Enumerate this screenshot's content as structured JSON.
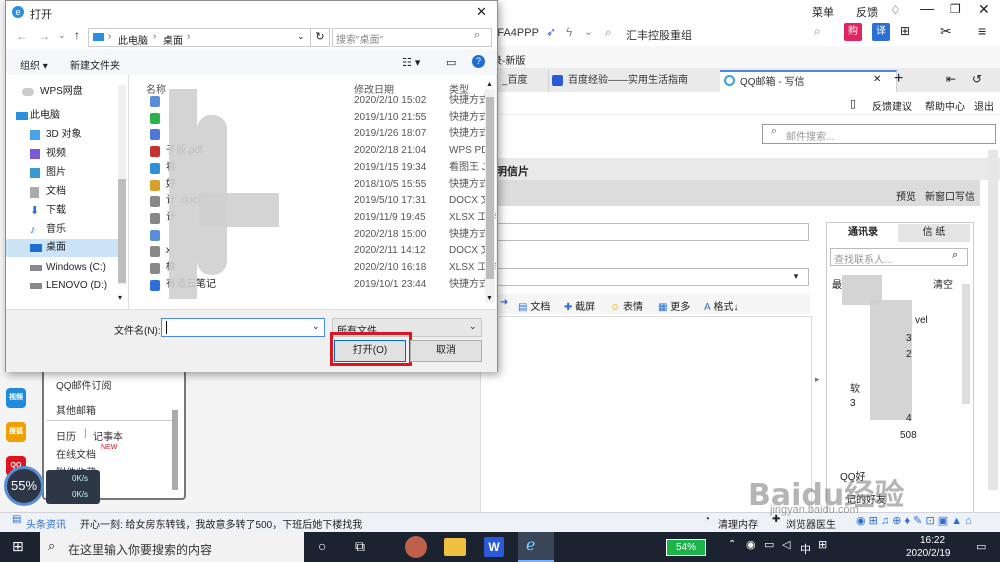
{
  "dialog": {
    "title": "打开",
    "breadcrumb": [
      "此电脑",
      "桌面"
    ],
    "search_placeholder": "搜索\"桌面\"",
    "toolbar": {
      "organize": "组织",
      "new_folder": "新建文件夹"
    },
    "tree": [
      "WPS网盘",
      "此电脑",
      "3D 对象",
      "视频",
      "图片",
      "文档",
      "下载",
      "音乐",
      "桌面",
      "Windows (C:)",
      "LENOVO (D:)"
    ],
    "columns": {
      "name": "名称",
      "date": "修改日期",
      "type": "类型"
    },
    "files": [
      {
        "name": "",
        "date": "2020/2/10 15:02",
        "type": "快捷方式"
      },
      {
        "name": "",
        "date": "2019/1/10 21:55",
        "type": "快捷方式"
      },
      {
        "name": "",
        "date": "2019/1/26 18:07",
        "type": "快捷方式"
      },
      {
        "name": "子版.pdf",
        "date": "2020/2/18 21:04",
        "type": "WPS PDF"
      },
      {
        "name": "看",
        "date": "2019/1/15 19:34",
        "type": "看图王 JP"
      },
      {
        "name": "好",
        "date": "2018/10/5 15:55",
        "type": "快捷方式"
      },
      {
        "name": "计  .docx",
        "date": "2019/5/10 17:31",
        "type": "DOCX 文"
      },
      {
        "name": "计",
        "date": "2019/11/9 19:45",
        "type": "XLSX 工作"
      },
      {
        "name": "",
        "date": "2020/2/18 15:00",
        "type": "快捷方式"
      },
      {
        "name": "x",
        "date": "2020/2/11 14:12",
        "type": "DOCX 文"
      },
      {
        "name": "橡",
        "date": "2020/2/10 16:18",
        "type": "XLSX 工作"
      },
      {
        "name": "有道云笔记",
        "date": "2019/10/1 23:44",
        "type": "快捷方式"
      }
    ],
    "filename_label": "文件名(N):",
    "filename_value": "",
    "filetype_value": "所有文件",
    "open_button": "打开(O)",
    "cancel_button": "取消"
  },
  "browser": {
    "address_fragment": "rrFA4PPP",
    "bookmark": "汇丰控股重组",
    "top_right": [
      "菜单",
      "反馈"
    ],
    "tabs": [
      "录-新版",
      "_百度",
      "百度经验——实用生活指南",
      "QQ邮箱 - 写信"
    ],
    "mail_links": [
      "反馈建议",
      "帮助中心",
      "退出"
    ],
    "mail_search_placeholder": "邮件搜索...",
    "compose_tab": "明信片",
    "compose_actions": [
      "预览",
      "新窗口写信"
    ],
    "editor_toolbar": [
      "文档",
      "截屏",
      "表情",
      "更多",
      "格式"
    ],
    "contacts": {
      "tab1": "通讯录",
      "tab2": "信 纸",
      "search_placeholder": "查找联系人...",
      "recent": "最",
      "clear": "清空",
      "items": [
        "vel",
        "3",
        "2",
        "软",
        "3",
        "4",
        "508"
      ],
      "bottom": [
        "QQ好",
        "记的好友"
      ]
    },
    "sidebar": [
      "QQ邮件订阅",
      "其他邮箱",
      "日历",
      "记事本",
      "在线文档",
      "附件收藏"
    ],
    "sidebar_badge": "NEW",
    "side_apps": [
      "视频",
      "搜狐",
      "QQ"
    ],
    "gauge": "55%",
    "speed": [
      "0K/s",
      "0K/s"
    ]
  },
  "statusbar": {
    "news": "头条资讯",
    "ticker": "开心一刻: 给女房东转钱，我故意多转了500，下班后她下楼找我",
    "clean": "清理内存",
    "doctor": "浏览器医生"
  },
  "taskbar": {
    "search_placeholder": "在这里输入你要搜索的内容",
    "battery": "54%",
    "ime": "中",
    "time": "16:22",
    "date": "2020/2/19"
  },
  "watermark": "Baidu经验",
  "watermark_url": "jingyan.baidu.com",
  "colors": {
    "highlight_red": "#e0141e",
    "accent_blue": "#0067c0",
    "taskbar": "#1b2330"
  }
}
